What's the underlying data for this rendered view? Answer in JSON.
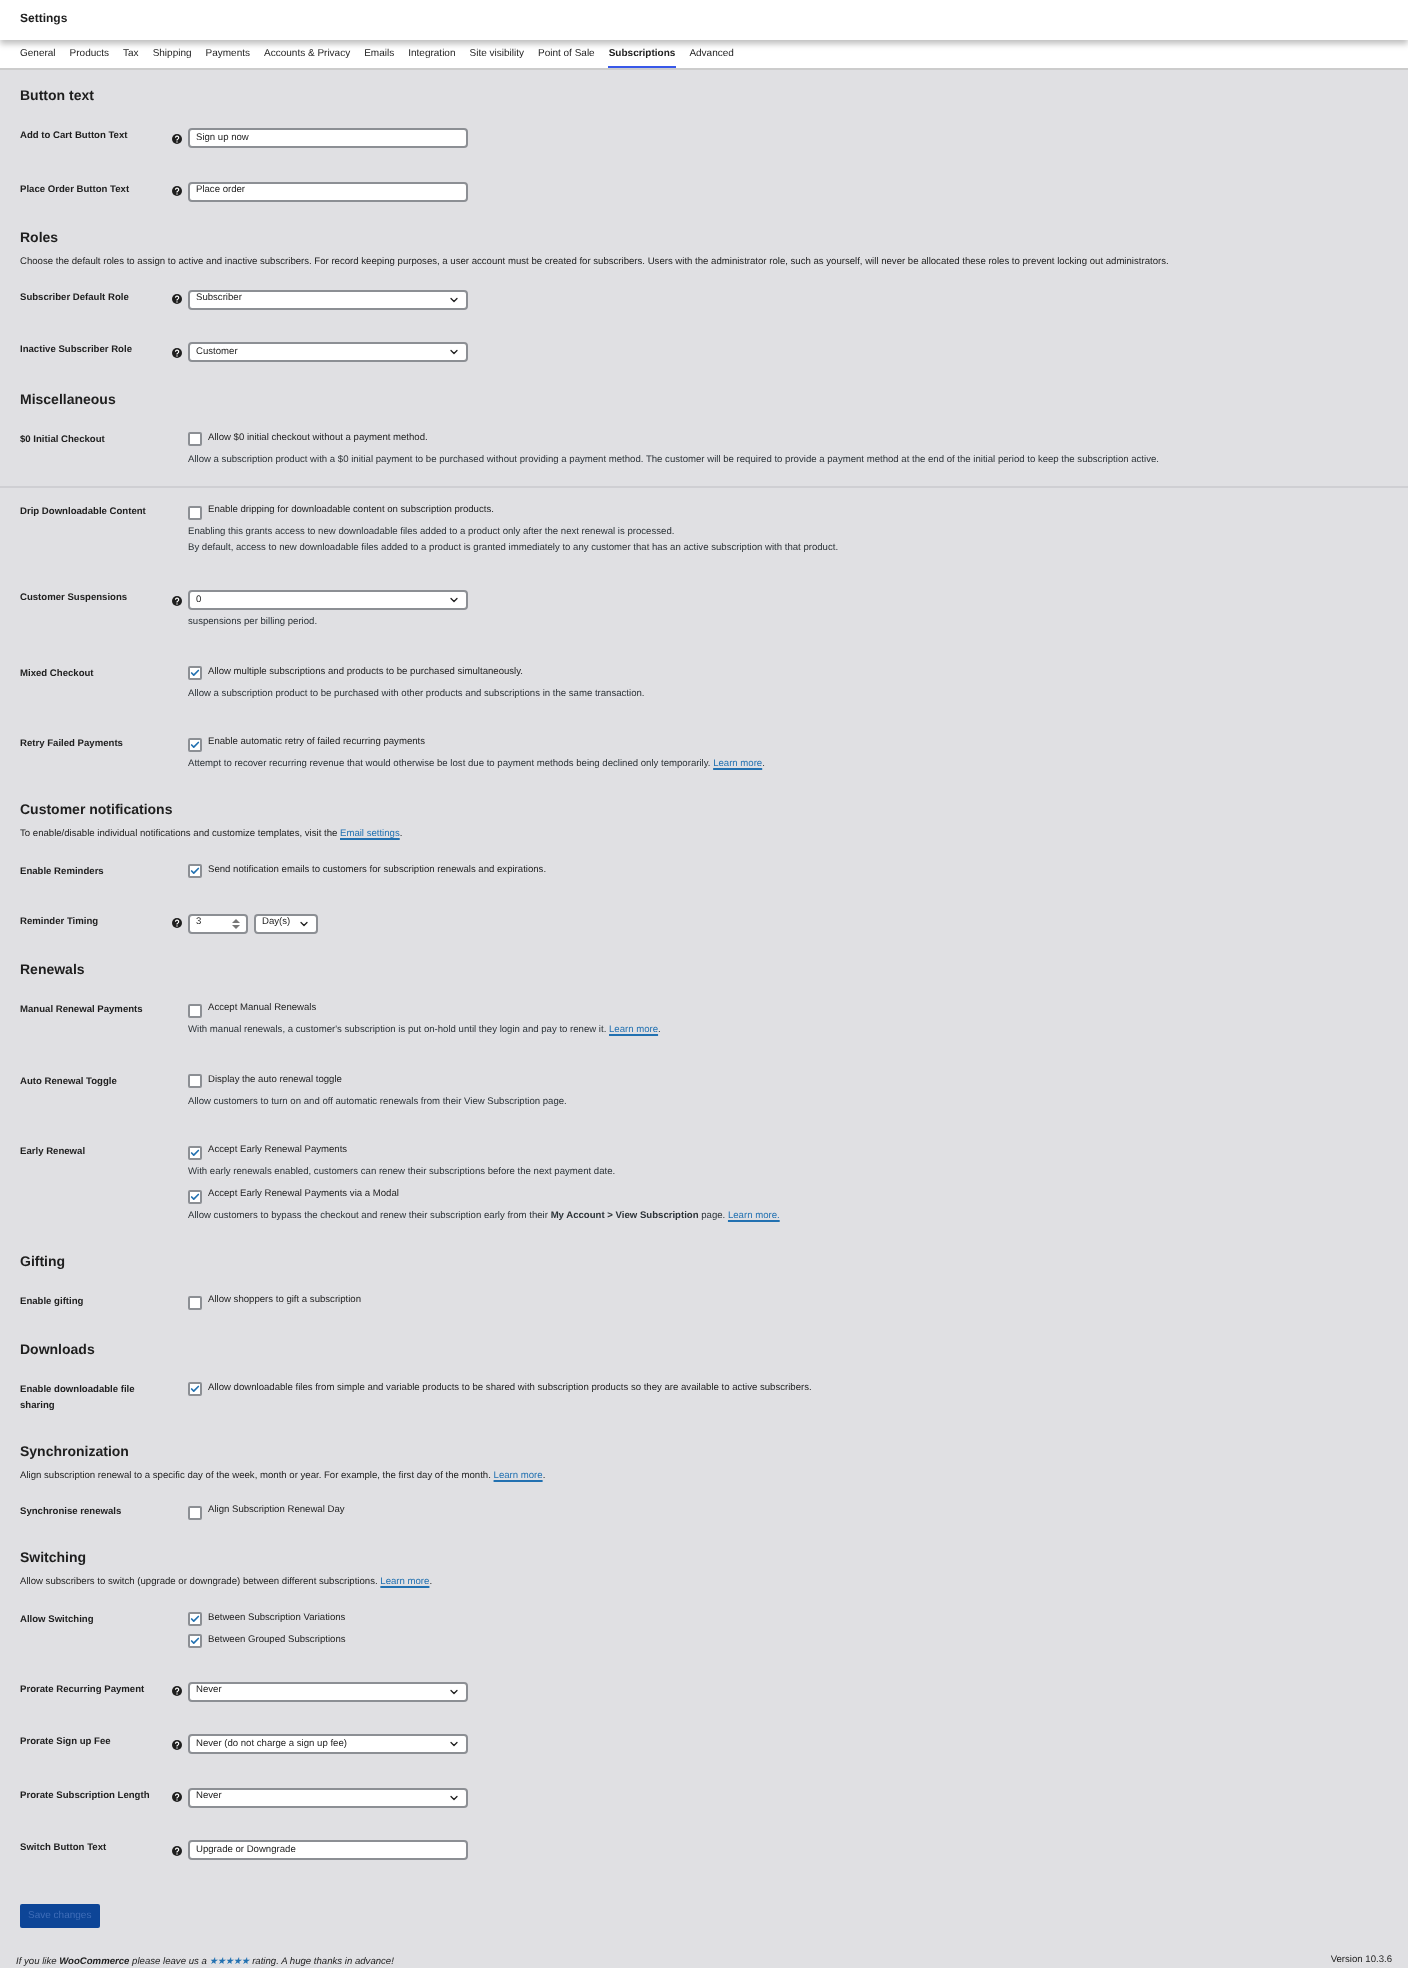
{
  "header": {
    "title": "Settings"
  },
  "tabs": [
    {
      "label": "General",
      "selected": false
    },
    {
      "label": "Products",
      "selected": false
    },
    {
      "label": "Tax",
      "selected": false
    },
    {
      "label": "Shipping",
      "selected": false
    },
    {
      "label": "Payments",
      "selected": false
    },
    {
      "label": "Accounts & Privacy",
      "selected": false
    },
    {
      "label": "Emails",
      "selected": false
    },
    {
      "label": "Integration",
      "selected": false
    },
    {
      "label": "Site visibility",
      "selected": false
    },
    {
      "label": "Point of Sale",
      "selected": false
    },
    {
      "label": "Subscriptions",
      "selected": true
    },
    {
      "label": "Advanced",
      "selected": false
    }
  ],
  "sections": [
    {
      "title": "Button text",
      "rows": [
        {
          "label": "Add to Cart Button Text",
          "help": true,
          "controls": [
            {
              "kind": "text",
              "value": "Sign up now"
            }
          ]
        },
        {
          "label": "Place Order Button Text",
          "help": true,
          "controls": [
            {
              "kind": "text",
              "value": "Place order"
            }
          ]
        }
      ]
    },
    {
      "title": "Roles",
      "description": {
        "text": "Choose the default roles to assign to active and inactive subscribers. For record keeping purposes, a user account must be created for subscribers. Users with the administrator role, such as yourself, will never be allocated these roles to prevent locking out administrators."
      },
      "rows": [
        {
          "label": "Subscriber Default Role",
          "help": true,
          "controls": [
            {
              "kind": "select",
              "value": "Subscriber"
            }
          ]
        },
        {
          "label": "Inactive Subscriber Role",
          "help": true,
          "controls": [
            {
              "kind": "select",
              "value": "Customer"
            }
          ]
        }
      ]
    },
    {
      "title": "Miscellaneous",
      "rows": [
        {
          "label": "$0 Initial Checkout",
          "help": false,
          "controls": [
            {
              "kind": "checkbox",
              "label": "Allow $0 initial checkout without a payment method.",
              "checked": false
            },
            {
              "kind": "note",
              "lines": [
                "Allow a subscription product with a $0 initial payment to be purchased without providing a payment method. The customer will be required to provide a payment method at the end of the initial period to keep the subscription active."
              ]
            }
          ]
        },
        {
          "label": "Drip Downloadable Content",
          "help": false,
          "divider": true,
          "controls": [
            {
              "kind": "checkbox",
              "label": "Enable dripping for downloadable content on subscription products.",
              "checked": false
            },
            {
              "kind": "note",
              "lines": [
                "Enabling this grants access to new downloadable files added to a product only after the next renewal is processed.",
                "By default, access to new downloadable files added to a product is granted immediately to any customer that has an active subscription with that product."
              ]
            }
          ]
        },
        {
          "label": "Customer Suspensions",
          "help": true,
          "controls": [
            {
              "kind": "select",
              "value": "0"
            },
            {
              "kind": "note",
              "lines": [
                "suspensions per billing period."
              ]
            }
          ]
        },
        {
          "label": "Mixed Checkout",
          "help": false,
          "controls": [
            {
              "kind": "checkbox",
              "label": "Allow multiple subscriptions and products to be purchased simultaneously.",
              "checked": true
            },
            {
              "kind": "note",
              "lines": [
                "Allow a subscription product to be purchased with other products and subscriptions in the same transaction."
              ]
            }
          ]
        },
        {
          "label": "Retry Failed Payments",
          "help": false,
          "controls": [
            {
              "kind": "checkbox",
              "label": "Enable automatic retry of failed recurring payments",
              "checked": true
            },
            {
              "kind": "note",
              "lines": [
                "Attempt to recover recurring revenue that would otherwise be lost due to payment methods being declined only temporarily."
              ],
              "link": "Learn more",
              "after": "."
            }
          ]
        }
      ]
    },
    {
      "title": "Customer notifications",
      "description": {
        "text": "To enable/disable individual notifications and customize templates, visit the",
        "link": "Email settings",
        "after": "."
      },
      "rows": [
        {
          "label": "Enable Reminders",
          "help": false,
          "controls": [
            {
              "kind": "checkbox",
              "label": "Send notification emails to customers for subscription renewals and expirations.",
              "checked": true
            }
          ]
        },
        {
          "label": "Reminder Timing",
          "help": true,
          "controls": [
            {
              "kind": "number_unit",
              "value": "3",
              "unit": "Day(s)"
            }
          ]
        }
      ]
    },
    {
      "title": "Renewals",
      "rows": [
        {
          "label": "Manual Renewal Payments",
          "help": false,
          "controls": [
            {
              "kind": "checkbox",
              "label": "Accept Manual Renewals",
              "checked": false
            },
            {
              "kind": "note",
              "lines": [
                "With manual renewals, a customer's subscription is put on-hold until they login and pay to renew it."
              ],
              "link": "Learn more",
              "after": "."
            }
          ]
        },
        {
          "label": "Auto Renewal Toggle",
          "help": false,
          "controls": [
            {
              "kind": "checkbox",
              "label": "Display the auto renewal toggle",
              "checked": false
            },
            {
              "kind": "note",
              "lines": [
                "Allow customers to turn on and off automatic renewals from their View Subscription page."
              ]
            }
          ]
        },
        {
          "label": "Early Renewal",
          "help": false,
          "controls": [
            {
              "kind": "checkbox",
              "label": "Accept Early Renewal Payments",
              "checked": true
            },
            {
              "kind": "note",
              "lines": [
                "With early renewals enabled, customers can renew their subscriptions before the next payment date."
              ]
            },
            {
              "kind": "checkbox",
              "label": "Accept Early Renewal Payments via a Modal",
              "checked": true
            },
            {
              "kind": "note",
              "lines": [
                "Allow customers to bypass the checkout and renew their subscription early from their **My Account > View Subscription** page."
              ],
              "link": "Learn more."
            }
          ]
        }
      ]
    },
    {
      "title": "Gifting",
      "rows": [
        {
          "label": "Enable gifting",
          "help": false,
          "controls": [
            {
              "kind": "checkbox",
              "label": "Allow shoppers to gift a subscription",
              "checked": false
            }
          ]
        }
      ]
    },
    {
      "title": "Downloads",
      "rows": [
        {
          "label": "Enable downloadable file sharing",
          "help": false,
          "controls": [
            {
              "kind": "checkbox",
              "label": "Allow downloadable files from simple and variable products to be shared with subscription products so they are available to active subscribers.",
              "checked": true
            }
          ]
        }
      ]
    },
    {
      "title": "Synchronization",
      "description": {
        "text": "Align subscription renewal to a specific day of the week, month or year. For example, the first day of the month.",
        "link": "Learn more",
        "after": "."
      },
      "rows": [
        {
          "label": "Synchronise renewals",
          "help": false,
          "controls": [
            {
              "kind": "checkbox",
              "label": "Align Subscription Renewal Day",
              "checked": false
            }
          ]
        }
      ]
    },
    {
      "title": "Switching",
      "description": {
        "text": "Allow subscribers to switch (upgrade or downgrade) between different subscriptions.",
        "link": "Learn more",
        "after": "."
      },
      "rows": [
        {
          "label": "Allow Switching",
          "help": false,
          "controls": [
            {
              "kind": "checkbox",
              "label": "Between Subscription Variations",
              "checked": true
            },
            {
              "kind": "checkbox",
              "label": "Between Grouped Subscriptions",
              "checked": true
            }
          ]
        },
        {
          "label": "Prorate Recurring Payment",
          "help": true,
          "controls": [
            {
              "kind": "select",
              "value": "Never"
            }
          ]
        },
        {
          "label": "Prorate Sign up Fee",
          "help": true,
          "controls": [
            {
              "kind": "select",
              "value": "Never (do not charge a sign up fee)"
            }
          ]
        },
        {
          "label": "Prorate Subscription Length",
          "help": true,
          "controls": [
            {
              "kind": "select",
              "value": "Never"
            }
          ]
        },
        {
          "label": "Switch Button Text",
          "help": true,
          "controls": [
            {
              "kind": "text",
              "value": "Upgrade or Downgrade"
            }
          ]
        }
      ]
    }
  ],
  "save_button": "Save changes",
  "footer": {
    "text": "If you like **WooCommerce** please leave us a",
    "link": "★★★★★",
    "after": "rating. A huge thanks in advance!",
    "version": "Version 10.3.6"
  }
}
